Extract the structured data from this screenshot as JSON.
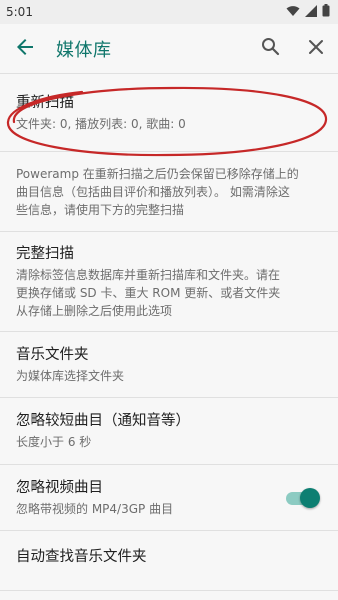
{
  "status_bar": {
    "time": "5:01",
    "icons": [
      "wifi-icon",
      "signal-icon",
      "battery-icon"
    ]
  },
  "app_bar": {
    "title": "媒体库",
    "back_icon": "arrow-back-icon",
    "search_icon": "search-icon",
    "close_icon": "close-icon",
    "accent_color": "#0f766b"
  },
  "preferences": {
    "rescan": {
      "title": "重新扫描",
      "summary": "文件夹: 0, 播放列表: 0, 歌曲: 0"
    },
    "info": {
      "lines": [
        "Poweramp 在重新扫描之后仍会保留已移除存储上的",
        "曲目信息（包括曲目评价和播放列表）。 如需清除这",
        "些信息，请使用下方的完整扫描"
      ]
    },
    "full_scan": {
      "title": "完整扫描",
      "summary_lines": [
        "清除标签信息数据库并重新扫描库和文件夹。请在",
        "更换存储或 SD 卡、重大 ROM 更新、或者文件夹",
        "从存储上删除之后使用此选项"
      ]
    },
    "music_folders": {
      "title": "音乐文件夹",
      "summary": "为媒体库选择文件夹"
    },
    "ignore_short": {
      "title": "忽略较短曲目（通知音等）",
      "summary": "长度小于 6 秒"
    },
    "ignore_video": {
      "title": "忽略视频曲目",
      "summary": "忽略带视频的 MP4/3GP 曲目",
      "enabled": true
    },
    "auto_find": {
      "title": "自动查找音乐文件夹"
    }
  },
  "annotation": {
    "type": "red-ellipse-highlight",
    "color": "#c62828",
    "target": "rescan"
  }
}
